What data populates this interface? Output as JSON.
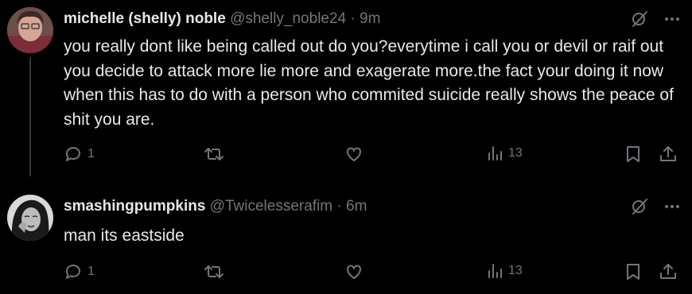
{
  "tweets": [
    {
      "name": "michelle (shelly) noble",
      "handle": "@shelly_noble24",
      "separator": "·",
      "time": "9m",
      "text": "you really dont like being called out do you?everytime i call you or devil or raif out you decide to attack more lie more and exagerate more.the fact your doing it now when this has to do with a person who commited suicide really shows the peace of shit you are.",
      "replies": "1",
      "views": "13"
    },
    {
      "name": "smashingpumpkins",
      "handle": "@Twicelesserafim",
      "separator": "·",
      "time": "6m",
      "text": "man its eastside",
      "replies": "1",
      "views": "13"
    }
  ],
  "icons": {
    "grok": "grok-icon",
    "more": "more-icon",
    "reply": "reply-icon",
    "retweet": "retweet-icon",
    "like": "heart-icon",
    "views": "views-icon",
    "bookmark": "bookmark-icon",
    "share": "share-icon"
  },
  "colors": {
    "background": "#000000",
    "text": "#e7e9ea",
    "muted": "#71767b",
    "thread_line": "#333639"
  }
}
